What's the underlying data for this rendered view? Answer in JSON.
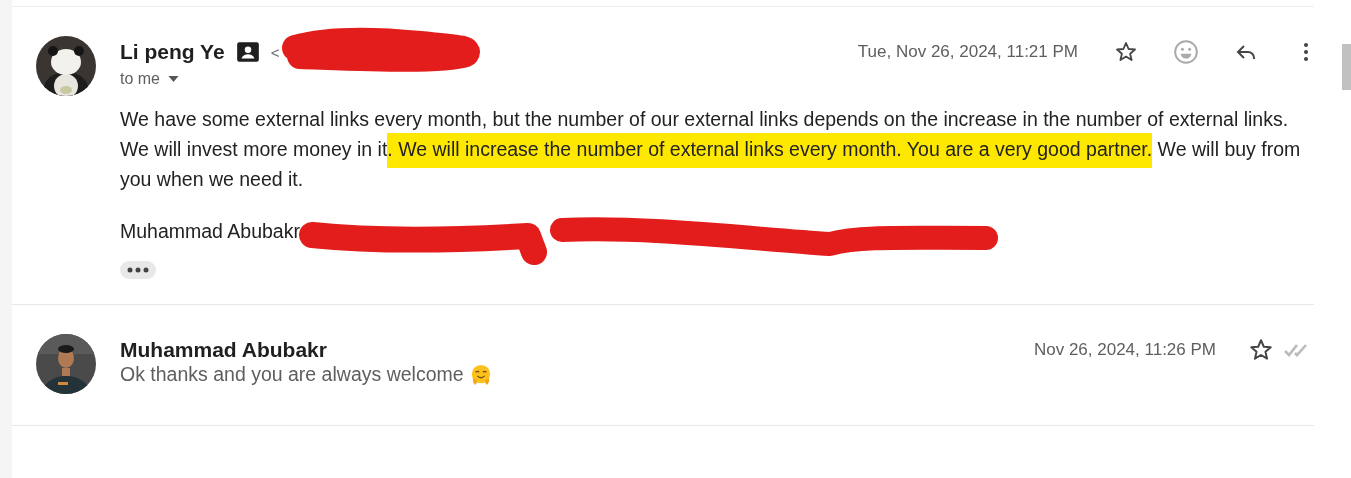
{
  "messages": [
    {
      "kind": "expanded",
      "sender": "Li peng Ye",
      "contact_card": true,
      "address_fragment": "<",
      "recipient": "to me",
      "date": "Tue, Nov 26, 2024, 11:21 PM",
      "starred": false,
      "body": [
        {
          "text": "We have some external links every month, but the number of our external links depends on the increase in the number of external links. We will invest more money in it",
          "highlighted": false
        },
        {
          "text": ". We will increase the number of external links every month. You are a very good partner.",
          "highlighted": true
        },
        {
          "text": " We will buy from you when we need it.",
          "highlighted": false
        }
      ],
      "signature": "Muhammad Abubakr"
    },
    {
      "kind": "collapsed",
      "sender": "Muhammad Abubakr",
      "snippet": "Ok thanks and you are always welcome",
      "date": "Nov 26, 2024, 11:26 PM",
      "starred": false,
      "read": true
    }
  ]
}
